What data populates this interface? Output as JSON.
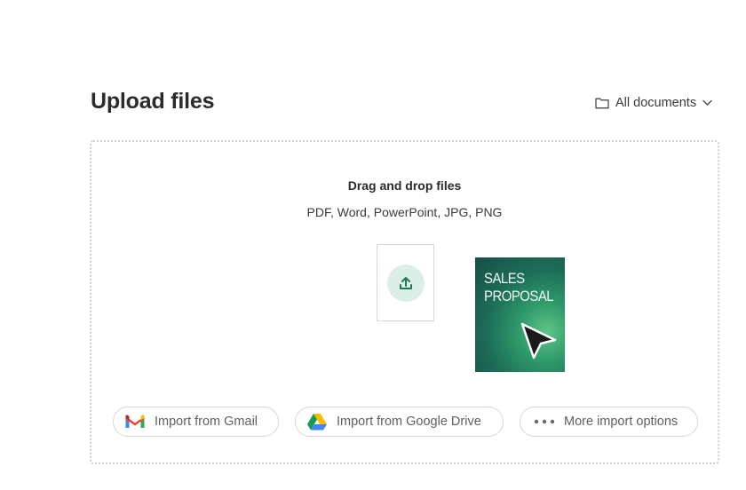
{
  "header": {
    "title": "Upload files",
    "folder_label": "All documents",
    "icons": {
      "folder": "folder-icon",
      "chevron": "chevron-down-icon"
    }
  },
  "dropzone": {
    "title": "Drag and drop files",
    "formats": "PDF, Word, PowerPoint, JPG, PNG",
    "upload_icon": "upload-icon",
    "accent_color": "#1f7a4f",
    "upload_bg_color": "#dcefe6"
  },
  "dragged_document": {
    "title_line1": "SALES",
    "title_line2": "PROPOSAL",
    "cursor_icon": "pointer-cursor-icon"
  },
  "imports": [
    {
      "label": "Import from Gmail",
      "icon": "gmail-icon"
    },
    {
      "label": "Import from Google Drive",
      "icon": "google-drive-icon"
    },
    {
      "label": "More import options",
      "icon": "more-dots-icon"
    }
  ]
}
